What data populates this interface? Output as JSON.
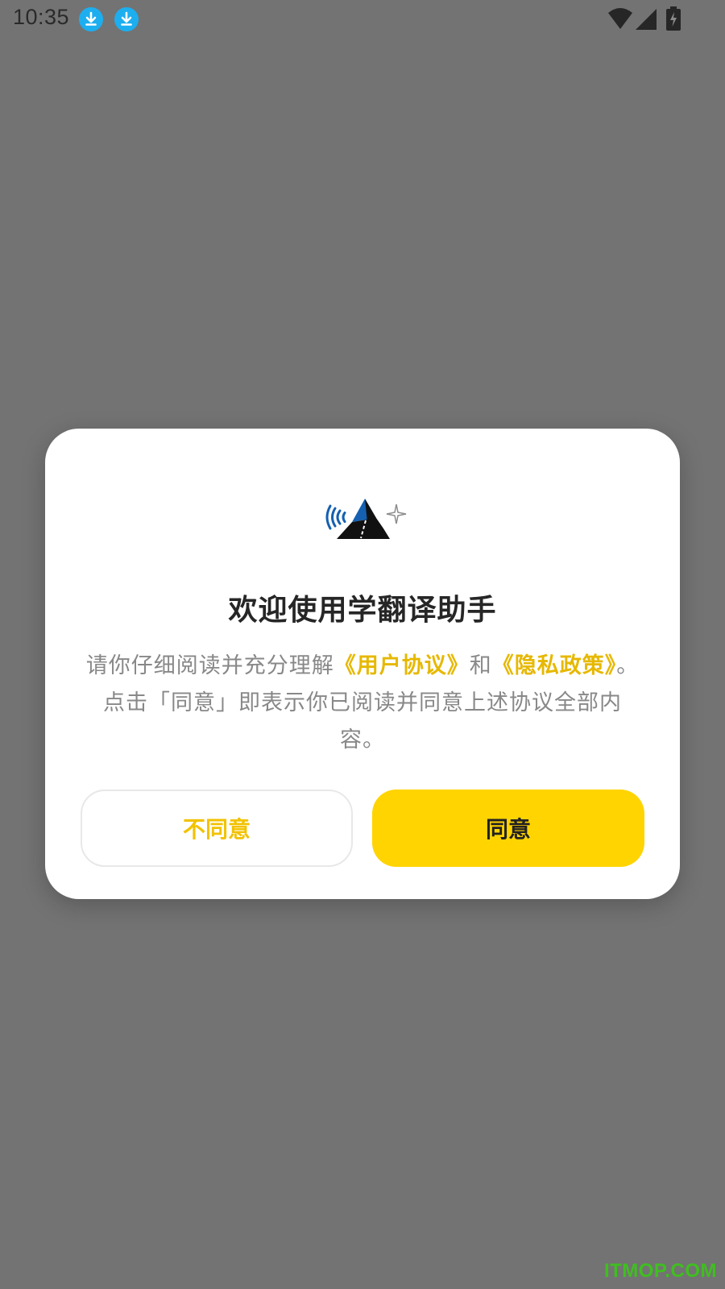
{
  "status_bar": {
    "time": "10:35",
    "icons": [
      "download-icon",
      "download-icon",
      "wifi-icon",
      "signal-icon",
      "battery-charging-icon"
    ]
  },
  "dialog": {
    "logo": "app-logo",
    "title": "欢迎使用学翻译助手",
    "body": {
      "intro": "请你仔细阅读并充分理解",
      "link_terms": "《用户协议》",
      "conjunction": "和",
      "link_privacy": "《隐私政策》",
      "rest": "。点击「同意」即表示你已阅读并同意上述协议全部内容。"
    },
    "buttons": {
      "disagree_label": "不同意",
      "agree_label": "同意"
    }
  },
  "watermark": "ITMOP.COM",
  "colors": {
    "overlay": "#737373",
    "accent": "#FFD400",
    "link": "#E6B800",
    "download_badge": "#1DAEEF",
    "logo_blue": "#1560B0"
  }
}
